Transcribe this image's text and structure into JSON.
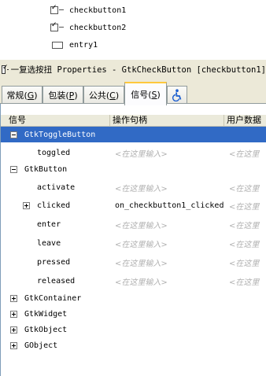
{
  "widget_tree": {
    "items": [
      {
        "label": "checkbutton1",
        "icon": "checkbutton-icon"
      },
      {
        "label": "checkbutton2",
        "icon": "checkbutton-icon"
      },
      {
        "label": "entry1",
        "icon": "entry-icon"
      }
    ]
  },
  "properties": {
    "title": "一复选按扭 Properties - GtkCheckButton [checkbutton1]"
  },
  "tabs": [
    {
      "label": "常规",
      "key": "G"
    },
    {
      "label": "包装",
      "key": "P"
    },
    {
      "label": "公共",
      "key": "C"
    },
    {
      "label": "信号",
      "key": "S",
      "active": true
    },
    {
      "label": "accessibility-icon"
    }
  ],
  "table": {
    "columns": [
      "信号",
      "操作句柄",
      "用户数据"
    ],
    "placeholder": "<在这里输入>",
    "rows": [
      {
        "name": "GtkToggleButton",
        "level": 0,
        "expander": "minus",
        "selected": true
      },
      {
        "name": "toggled",
        "level": 1,
        "handler": "<在这里输入>",
        "user_data": "<在这里"
      },
      {
        "name": "GtkButton",
        "level": 0,
        "expander": "minus"
      },
      {
        "name": "activate",
        "level": 1,
        "handler": "<在这里输入>",
        "user_data": "<在这里"
      },
      {
        "name": "clicked",
        "level": 1,
        "expander": "plus",
        "handler": "on_checkbutton1_clicked",
        "user_data": "<在这里"
      },
      {
        "name": "enter",
        "level": 1,
        "handler": "<在这里输入>",
        "user_data": "<在这里"
      },
      {
        "name": "leave",
        "level": 1,
        "handler": "<在这里输入>",
        "user_data": "<在这里"
      },
      {
        "name": "pressed",
        "level": 1,
        "handler": "<在这里输入>",
        "user_data": "<在这里"
      },
      {
        "name": "released",
        "level": 1,
        "handler": "<在这里输入>",
        "user_data": "<在这里"
      },
      {
        "name": "GtkContainer",
        "level": 0,
        "expander": "plus"
      },
      {
        "name": "GtkWidget",
        "level": 0,
        "expander": "plus"
      },
      {
        "name": "GtkObject",
        "level": 0,
        "expander": "plus"
      },
      {
        "name": "GObject",
        "level": 0,
        "expander": "plus"
      }
    ]
  },
  "colors": {
    "selection": "#316ac5",
    "active_tab_accent": "#ffc83c",
    "placeholder": "#b0b0b0"
  }
}
